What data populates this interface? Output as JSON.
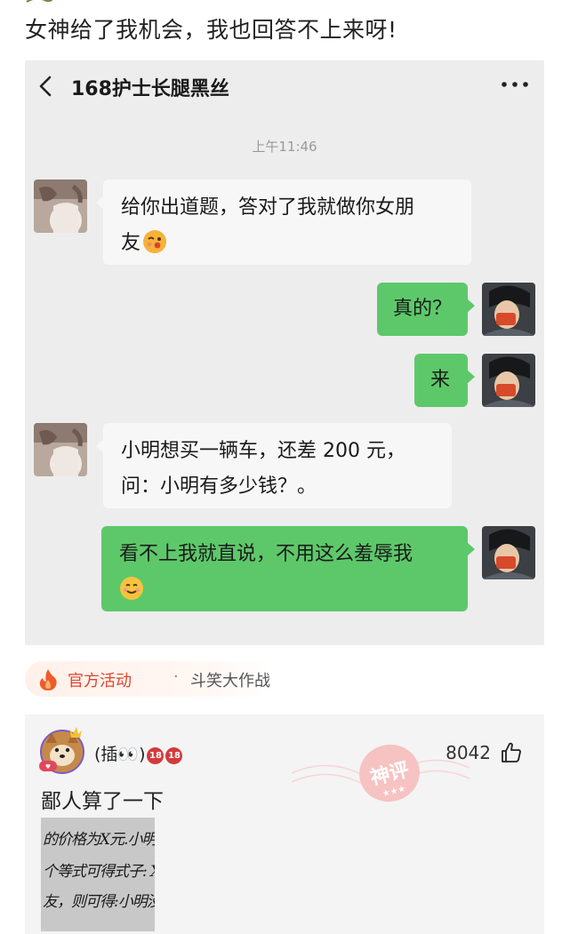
{
  "post": {
    "text": "女神给了我机会，我也回答不上来呀!"
  },
  "chat": {
    "title": "168护士长腿黑丝",
    "timestamp": "上午11:46",
    "messages": [
      {
        "side": "left",
        "text": "给你出道题，答对了我就做你女朋友",
        "line1": "给你出道题，答对了我就做你女朋",
        "line2": "友",
        "emoji": "kissing-face-emoji"
      },
      {
        "side": "right",
        "text": "真的？"
      },
      {
        "side": "right",
        "text": "来"
      },
      {
        "side": "left",
        "text": "小明想买一辆车，还差 200 元，问：小明有多少钱？。",
        "line1": "小明想买一辆车，还差 200 元，",
        "line2": "问：小明有多少钱？。"
      },
      {
        "side": "right",
        "text": "看不上我就直说，不用这么羞辱我",
        "line1": "看不上我就直说，不用这么羞辱我",
        "emoji": "smiling-face-emoji"
      }
    ]
  },
  "activity": {
    "icon": "fire-icon",
    "name": "官方活动",
    "separator": "·",
    "subtitle": "斗笑大作战"
  },
  "comment": {
    "username": "(插👀)",
    "badge": "18",
    "likes": "8042",
    "text": "鄙人算了一下",
    "stamp": "神评",
    "image_lines": [
      "的价格为X元.小明",
      "个等式可得式子: X-",
      "友，则可得:小明没"
    ]
  },
  "colors": {
    "chat_bg": "#ededed",
    "right_bubble": "#5dc86a",
    "left_bubble": "#f7f7f7",
    "activity_accent": "#e0452c",
    "card_bg": "#f4f4f4"
  }
}
